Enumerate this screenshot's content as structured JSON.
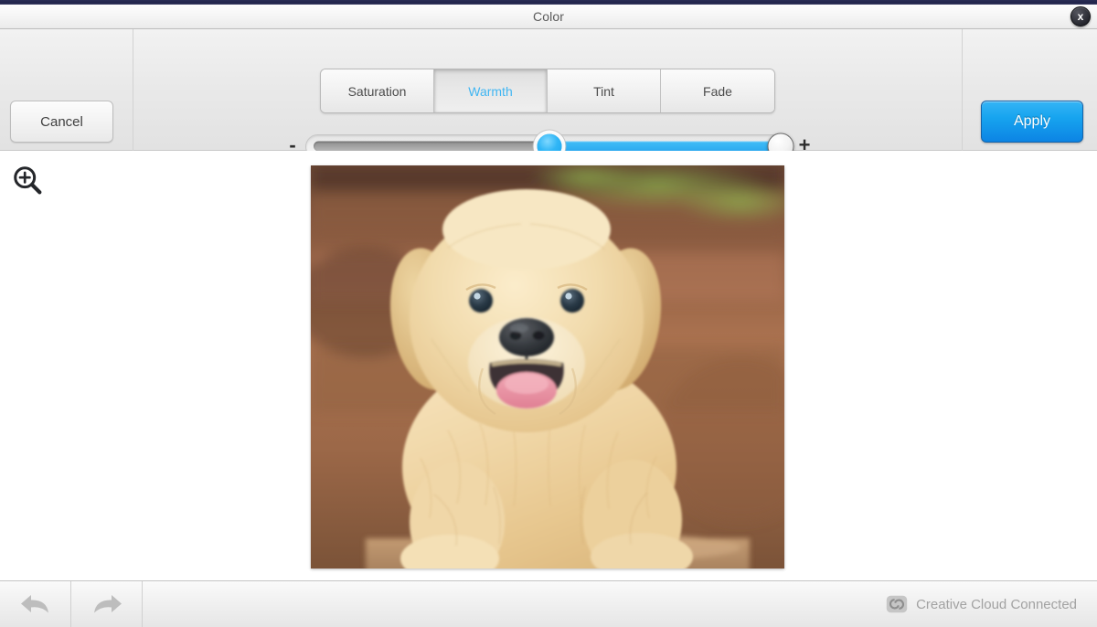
{
  "window": {
    "title": "Color",
    "close_label": "x",
    "close_icon": "close-icon"
  },
  "controls": {
    "cancel_label": "Cancel",
    "apply_label": "Apply",
    "accent_color": "#17a4ef",
    "active_tab_text_color": "#41b6f2"
  },
  "tabs": [
    {
      "label": "Saturation",
      "active": false
    },
    {
      "label": "Warmth",
      "active": true
    },
    {
      "label": "Tint",
      "active": false
    },
    {
      "label": "Fade",
      "active": false
    }
  ],
  "slider": {
    "name": "warmth-slider",
    "decrease_label": "-",
    "increase_label": "+",
    "origin_percent": 50,
    "value_percent": 99,
    "fill_color": "#34b3f3",
    "origin_color": "#30b6f6"
  },
  "canvas": {
    "zoom_icon": "zoom-in-magnifier-icon",
    "photo_alt": "golden retriever puppy photo"
  },
  "bottombar": {
    "undo_icon": "undo-arrow-icon",
    "redo_icon": "redo-arrow-icon",
    "cc_icon": "creative-cloud-icon",
    "cc_status_label": "Creative Cloud Connected"
  }
}
